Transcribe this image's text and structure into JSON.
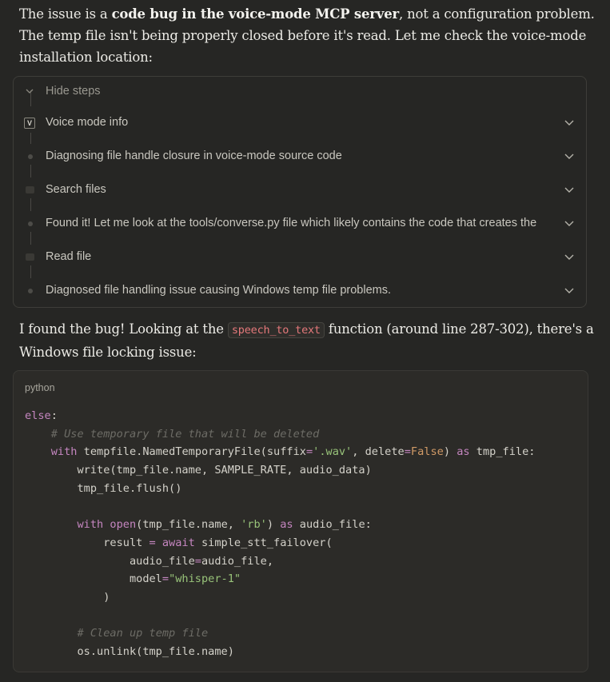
{
  "intro": {
    "before": "The issue is a ",
    "bold": "code bug in the voice-mode MCP server",
    "after": ", not a configuration problem. The temp file isn't being properly closed before it's read. Let me check the voice-mode installation location:"
  },
  "steps": {
    "toggle_label": "Hide steps",
    "items": [
      {
        "label": "Voice mode info",
        "icon": "v-badge-icon"
      },
      {
        "label": "Diagnosing file handle closure in voice-mode source code",
        "icon": "dot-icon"
      },
      {
        "label": "Search files",
        "icon": "box-icon"
      },
      {
        "label": "Found it! Let me look at the tools/converse.py file which likely contains the code that creates the",
        "icon": "dot-icon"
      },
      {
        "label": "Read file",
        "icon": "box-icon"
      },
      {
        "label": "Diagnosed file handling issue causing Windows temp file problems.",
        "icon": "dot-icon"
      }
    ]
  },
  "finding": {
    "before": "I found the bug! Looking at the ",
    "code": "speech_to_text",
    "after": " function (around line 287-302), there's a Windows file locking issue:"
  },
  "codeblock": {
    "language": "python",
    "lines": [
      "else:",
      "    # Use temporary file that will be deleted",
      "    with tempfile.NamedTemporaryFile(suffix='.wav', delete=False) as tmp_file:",
      "        write(tmp_file.name, SAMPLE_RATE, audio_data)",
      "        tmp_file.flush()",
      "",
      "        with open(tmp_file.name, 'rb') as audio_file:",
      "            result = await simple_stt_failover(",
      "                audio_file=audio_file,",
      "                model=\"whisper-1\"",
      "            )",
      "",
      "        # Clean up temp file",
      "        os.unlink(tmp_file.name)"
    ]
  },
  "colors": {
    "background": "#262624",
    "code_bg": "#2c2b28",
    "keyword": "#c586c0",
    "string": "#98c379",
    "comment": "#6d6c66",
    "inline_code": "#e4787a"
  }
}
